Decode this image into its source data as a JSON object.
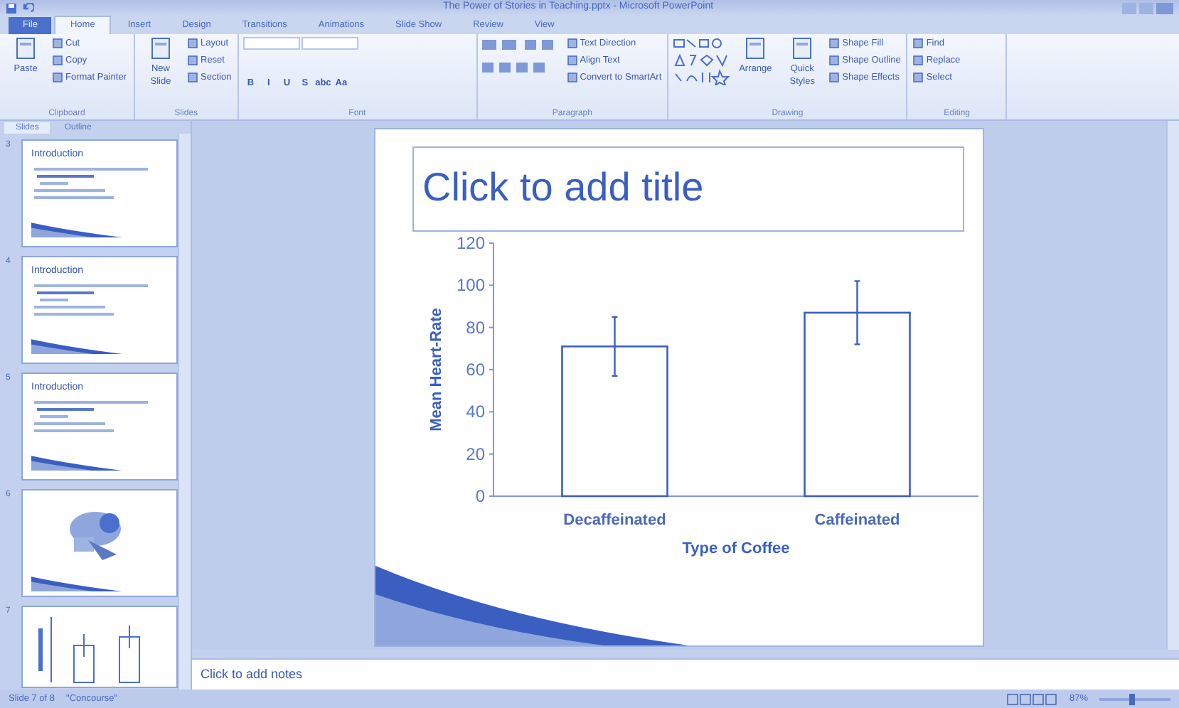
{
  "window": {
    "title": "The Power of Stories in Teaching.pptx - Microsoft PowerPoint"
  },
  "tabs": [
    {
      "label": "File",
      "selected": false,
      "kind": "file"
    },
    {
      "label": "Home",
      "selected": true,
      "kind": "tab"
    },
    {
      "label": "Insert",
      "selected": false,
      "kind": "tab"
    },
    {
      "label": "Design",
      "selected": false,
      "kind": "tab"
    },
    {
      "label": "Transitions",
      "selected": false,
      "kind": "tab"
    },
    {
      "label": "Animations",
      "selected": false,
      "kind": "tab"
    },
    {
      "label": "Slide Show",
      "selected": false,
      "kind": "tab"
    },
    {
      "label": "Review",
      "selected": false,
      "kind": "tab"
    },
    {
      "label": "View",
      "selected": false,
      "kind": "tab"
    }
  ],
  "ribbon": {
    "groups": [
      {
        "label": "Clipboard",
        "buttons": [
          {
            "label": "Paste",
            "kind": "large"
          },
          {
            "label": "Cut",
            "kind": "small"
          },
          {
            "label": "Copy",
            "kind": "small"
          },
          {
            "label": "Format Painter",
            "kind": "small"
          }
        ]
      },
      {
        "label": "Slides",
        "buttons": [
          {
            "label": "New Slide",
            "kind": "large"
          },
          {
            "label": "Layout",
            "kind": "small"
          },
          {
            "label": "Reset",
            "kind": "small"
          },
          {
            "label": "Section",
            "kind": "small"
          }
        ]
      },
      {
        "label": "Font",
        "buttons": [
          {
            "kind": "combo"
          },
          {
            "kind": "combo"
          },
          {
            "label": "B",
            "kind": "glyph"
          },
          {
            "label": "I",
            "kind": "glyph"
          },
          {
            "label": "U",
            "kind": "glyph"
          },
          {
            "label": "S",
            "kind": "glyph"
          },
          {
            "label": "abc",
            "kind": "glyph"
          },
          {
            "label": "Aa",
            "kind": "glyph"
          }
        ]
      },
      {
        "label": "Paragraph",
        "buttons": [
          {
            "kind": "icons"
          },
          {
            "label": "Text Direction",
            "kind": "small"
          },
          {
            "label": "Align Text",
            "kind": "small"
          },
          {
            "label": "Convert to SmartArt",
            "kind": "small"
          }
        ]
      },
      {
        "label": "Drawing",
        "buttons": [
          {
            "kind": "gallery"
          },
          {
            "label": "Arrange",
            "kind": "large"
          },
          {
            "label": "Quick Styles",
            "kind": "large"
          },
          {
            "label": "Shape Fill",
            "kind": "small"
          },
          {
            "label": "Shape Outline",
            "kind": "small"
          },
          {
            "label": "Shape Effects",
            "kind": "small"
          }
        ]
      },
      {
        "label": "Editing",
        "buttons": [
          {
            "label": "Find",
            "kind": "small"
          },
          {
            "label": "Replace",
            "kind": "small"
          },
          {
            "label": "Select",
            "kind": "small"
          }
        ]
      }
    ]
  },
  "pane_tabs": [
    {
      "label": "Slides",
      "selected": true
    },
    {
      "label": "Outline",
      "selected": false
    }
  ],
  "thumbnails": [
    {
      "number": "3",
      "kind": "text",
      "title": "Introduction"
    },
    {
      "number": "4",
      "kind": "text",
      "title": "Introduction"
    },
    {
      "number": "5",
      "kind": "text",
      "title": "Introduction"
    },
    {
      "number": "6",
      "kind": "picture"
    },
    {
      "number": "7",
      "kind": "chart"
    }
  ],
  "slide": {
    "title_placeholder": "Click to add title",
    "chart_data": {
      "type": "bar",
      "xlabel": "Type of Coffee",
      "ylabel": "Mean Heart-Rate",
      "categories": [
        "Decaffeinated",
        "Caffeinated"
      ],
      "ylim": [
        0,
        120
      ],
      "yticks": [
        0,
        20,
        40,
        60,
        80,
        100,
        120
      ],
      "series": [
        {
          "color": "#3a5fc0",
          "values": [
            71,
            87
          ],
          "errors": [
            14,
            15
          ]
        }
      ]
    }
  },
  "notes": {
    "placeholder": "Click to add notes"
  },
  "status_bar": {
    "slide": "Slide 7 of 8",
    "theme": "\"Concourse\"",
    "zoom": "87%",
    "zoom_slider": {
      "level": 0.45
    }
  }
}
